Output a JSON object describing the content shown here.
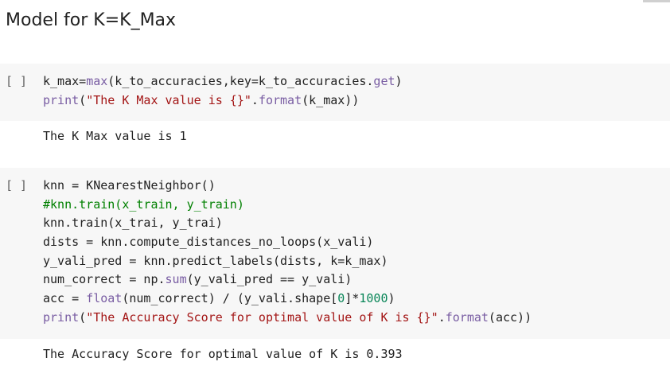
{
  "heading": "Model for K=K_Max",
  "cells": [
    {
      "run_label": "[ ]",
      "code_lines": [
        "k_max=max(k_to_accuracies,key=k_to_accuracies.get)",
        "print(\"The K Max value is {}\".format(k_max))"
      ],
      "output": "The K Max value is 1"
    },
    {
      "run_label": "[ ]",
      "code_lines": [
        "knn = KNearestNeighbor()",
        "#knn.train(x_train, y_train)",
        "knn.train(x_trai, y_trai)",
        "dists = knn.compute_distances_no_loops(x_vali)",
        "y_vali_pred = knn.predict_labels(dists, k=k_max)",
        "num_correct = np.sum(y_vali_pred == y_vali)",
        "acc = float(num_correct) / (y_vali.shape[0]*1000)",
        "print(\"The Accuracy Score for optimal value of K is {}\".format(acc))"
      ],
      "output": "The Accuracy Score for optimal value of K is 0.393"
    }
  ],
  "colors": {
    "cell_background": "#f7f7f7",
    "text": "#212121",
    "builtin": "#795da3",
    "string": "#a31515",
    "comment": "#008000",
    "number": "#098658"
  }
}
